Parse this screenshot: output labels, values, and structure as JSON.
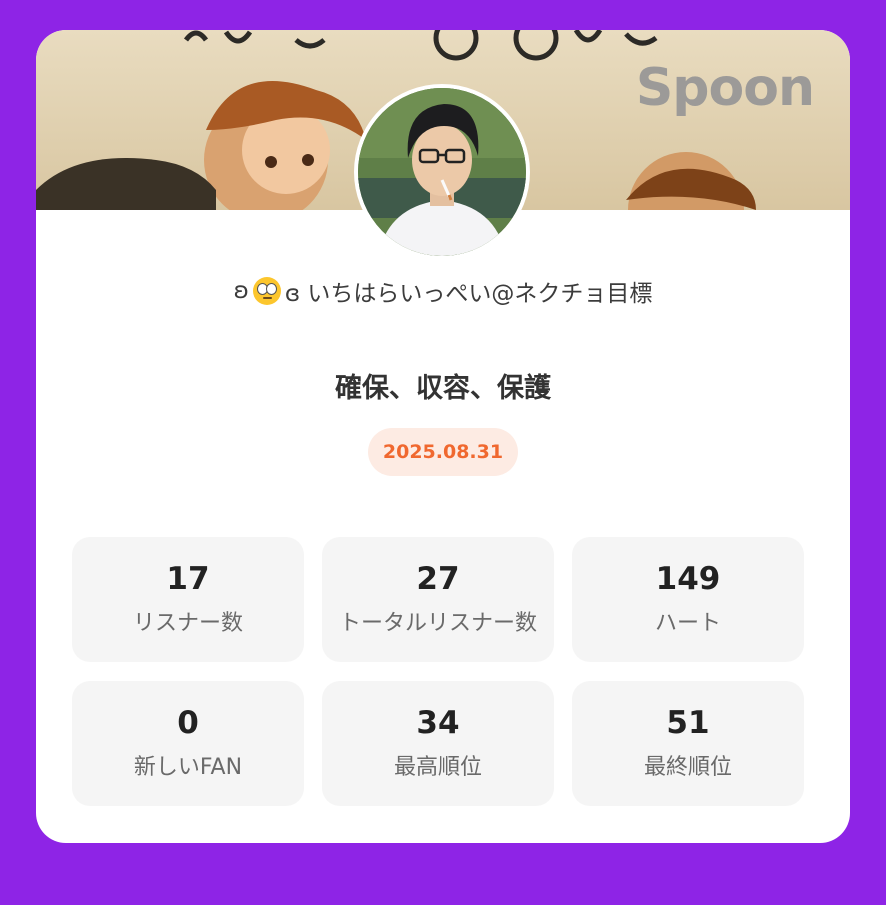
{
  "banner": {
    "logo_text": "Spoon"
  },
  "host": {
    "name_prefix": "ʚ",
    "emoji": "face-with-rolling-eyes",
    "name_suffix": "ɞ いちはらいっぺい@ネクチョ目標"
  },
  "live": {
    "title": "確保、収容、保護",
    "date": "2025.08.31"
  },
  "stats": [
    {
      "value": "17",
      "label": "リスナー数"
    },
    {
      "value": "27",
      "label": "トータルリスナー数"
    },
    {
      "value": "149",
      "label": "ハート"
    },
    {
      "value": "0",
      "label": "新しいFAN"
    },
    {
      "value": "34",
      "label": "最高順位"
    },
    {
      "value": "51",
      "label": "最終順位"
    }
  ],
  "colors": {
    "background": "#8e24e6",
    "card": "#ffffff",
    "date_text": "#f0682f",
    "date_pill": "#fdebe3",
    "stat_box": "#f5f5f5"
  }
}
